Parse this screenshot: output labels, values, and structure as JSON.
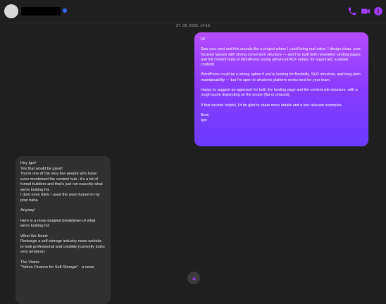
{
  "header": {
    "icons": {
      "call": "phone-icon",
      "video": "video-camera-icon",
      "info": "info-icon"
    },
    "accent_color": "#a23cff",
    "online_color": "#2f6bff"
  },
  "timestamp": "27. 06. 2025. 14:15",
  "outgoing_message": {
    "paragraphs": [
      "Hi!",
      "Saw your post and this sounds like a project where I could bring real value. I design clean, user-focused layouts with strong conversion structure — and I've built both newsletter landing pages and full content hubs in WordPress (using advanced ACF setups for organized, scalable content).",
      "WordPress could be a strong option if you're looking for flexibility, SEO structure, and long-term maintainability — but I'm open to whatever platform works best for your team.",
      "Happy to suggest an approach for both the landing page and the content site structure, with a rough quote depending on the scope (flat or phased).",
      "If that sounds helpful, I'd be glad to share more details and a few relevant examples.",
      "Best,\nIgor"
    ],
    "gradient": [
      "#b54cff",
      "#6a3bff"
    ]
  },
  "incoming_message": {
    "paragraphs": [
      "Hey Igor!\nYes that would be great!\nYou're one of the very few people who have even mentioned the content hub - it's a lot of funnel builders and that's just not exacctly what we're looking for.\nI dont even think I used the word funnel in my post haha",
      "Anyway!",
      "Here is a more detailed breakdown of what we're looking for:",
      "What We Need:\nRedesign a self-storage industry news website to look professional and credible (currently looks very amateur)",
      "The Vision:\n\"Yahoo Finance for Self-Storage\" - a news"
    ]
  },
  "scroll_button": {
    "icon": "arrow-down-icon"
  }
}
